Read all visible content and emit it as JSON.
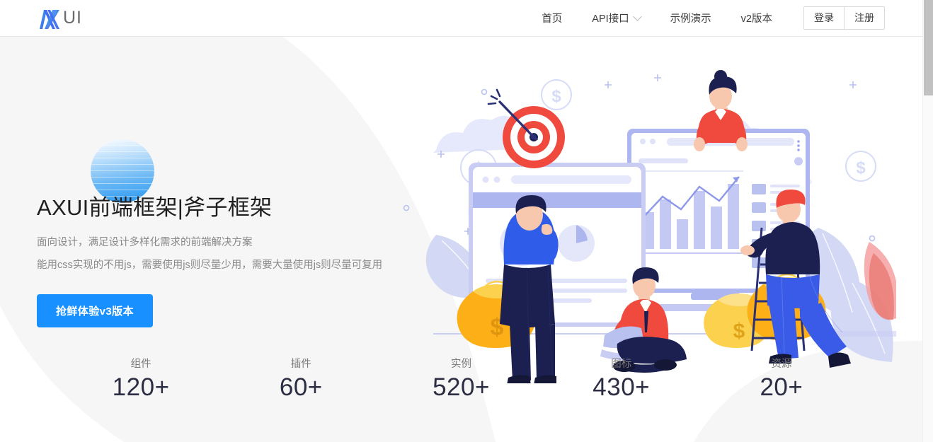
{
  "header": {
    "logo": {
      "mark_icon": "axui-logo-icon",
      "text": "UI"
    },
    "nav": [
      {
        "label": "首页",
        "icon": null
      },
      {
        "label": "API接口",
        "icon": "chevron-down-icon"
      },
      {
        "label": "示例演示",
        "icon": null
      },
      {
        "label": "v2版本",
        "icon": null
      }
    ],
    "auth": {
      "login_label": "登录",
      "register_label": "注册"
    }
  },
  "hero": {
    "title": "AXUI前端框架|斧子框架",
    "subtitle_1": "面向设计，满足设计多样化需求的前端解决方案",
    "subtitle_2": "能用css实现的不用js，需要使用js则尽量少用，需要大量使用js则尽量可复用",
    "cta_label": "抢鲜体验v3版本",
    "orb_icon": "gradient-sphere-icon",
    "illustration_icon": "business-analytics-illustration"
  },
  "stats": [
    {
      "label": "组件",
      "value": "120+"
    },
    {
      "label": "插件",
      "value": "60+"
    },
    {
      "label": "实例",
      "value": "520+"
    },
    {
      "label": "图标",
      "value": "430+"
    },
    {
      "label": "资源",
      "value": "20+"
    }
  ],
  "colors": {
    "accent": "#1890ff",
    "hero_bg": "#f6f6f7",
    "page_bg": "#ffffff",
    "stat_value": "#2b2d42",
    "text_muted": "#8a8a8a",
    "logo_text": "#6b6b6b",
    "border": "#e8e8e8",
    "illustration_red": "#f04a3f",
    "illustration_gold": "#fcaf17",
    "illustration_navy": "#1b2050",
    "illustration_blue": "#4a66e8",
    "illustration_lavender": "#c9cdf4"
  },
  "scrollbar": {
    "thumb_position": "top"
  }
}
